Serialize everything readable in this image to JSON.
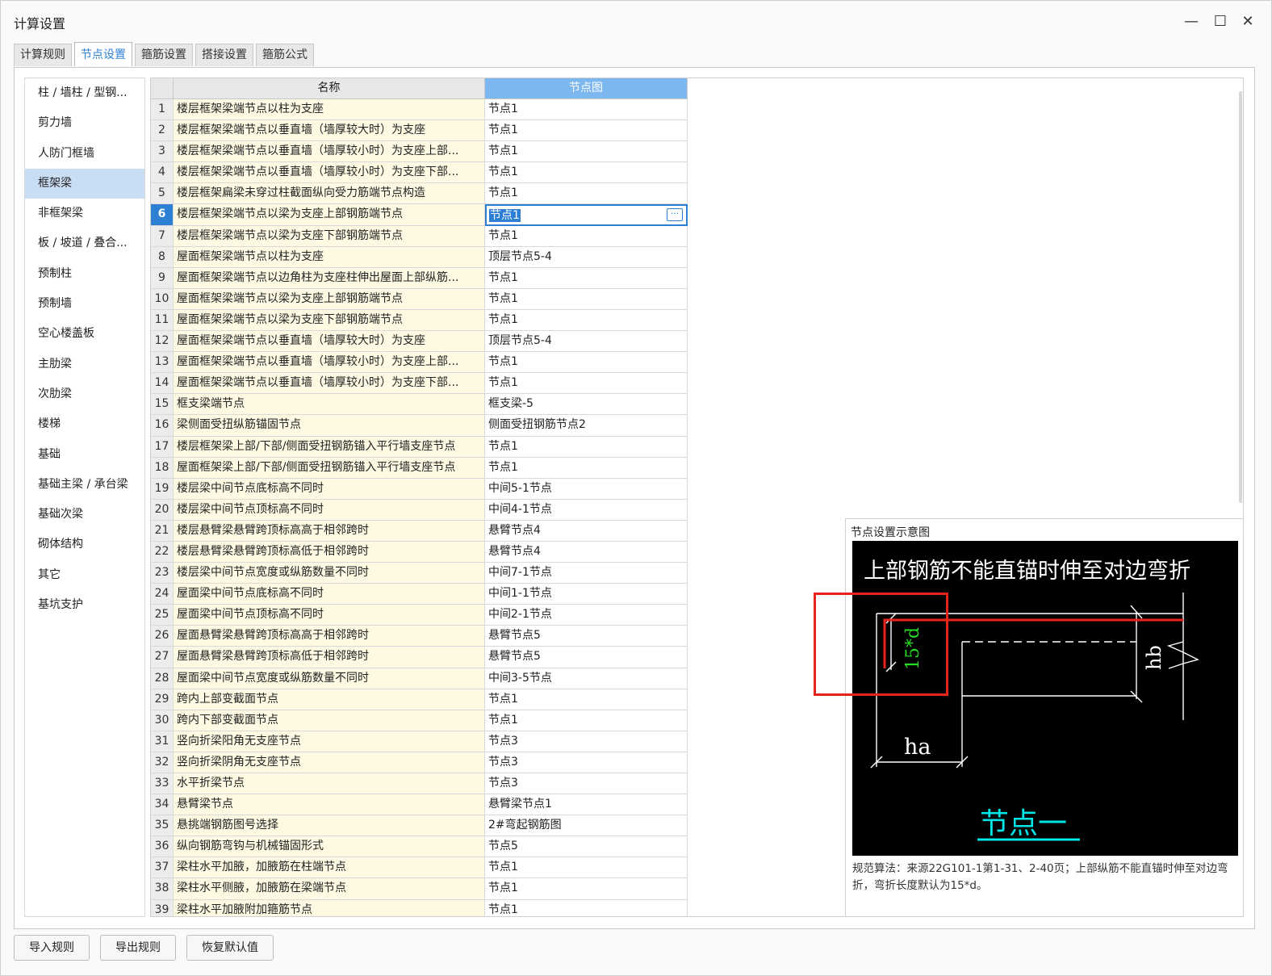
{
  "window": {
    "title": "计算设置"
  },
  "tabs": [
    {
      "label": "计算规则",
      "active": false
    },
    {
      "label": "节点设置",
      "active": true
    },
    {
      "label": "箍筋设置",
      "active": false
    },
    {
      "label": "搭接设置",
      "active": false
    },
    {
      "label": "箍筋公式",
      "active": false
    }
  ],
  "nav": [
    {
      "label": "柱 / 墙柱 / 型钢...",
      "selected": false
    },
    {
      "label": "剪力墙",
      "selected": false
    },
    {
      "label": "人防门框墙",
      "selected": false
    },
    {
      "label": "框架梁",
      "selected": true
    },
    {
      "label": "非框架梁",
      "selected": false
    },
    {
      "label": "板 / 坡道 / 叠合...",
      "selected": false
    },
    {
      "label": "预制柱",
      "selected": false
    },
    {
      "label": "预制墙",
      "selected": false
    },
    {
      "label": "空心楼盖板",
      "selected": false
    },
    {
      "label": "主肋梁",
      "selected": false
    },
    {
      "label": "次肋梁",
      "selected": false
    },
    {
      "label": "楼梯",
      "selected": false
    },
    {
      "label": "基础",
      "selected": false
    },
    {
      "label": "基础主梁 / 承台梁",
      "selected": false
    },
    {
      "label": "基础次梁",
      "selected": false
    },
    {
      "label": "砌体结构",
      "selected": false
    },
    {
      "label": "其它",
      "selected": false
    },
    {
      "label": "基坑支护",
      "selected": false
    }
  ],
  "table": {
    "headers": {
      "name": "名称",
      "value": "节点图"
    },
    "active_row": 6,
    "ellipsis_label": "···",
    "rows": [
      {
        "num": "1",
        "name": "楼层框架梁端节点以柱为支座",
        "value": "节点1"
      },
      {
        "num": "2",
        "name": "楼层框架梁端节点以垂直墙（墙厚较大时）为支座",
        "value": "节点1"
      },
      {
        "num": "3",
        "name": "楼层框架梁端节点以垂直墙（墙厚较小时）为支座上部...",
        "value": "节点1"
      },
      {
        "num": "4",
        "name": "楼层框架梁端节点以垂直墙（墙厚较小时）为支座下部...",
        "value": "节点1"
      },
      {
        "num": "5",
        "name": "楼层框架扁梁未穿过柱截面纵向受力筋端节点构造",
        "value": "节点1"
      },
      {
        "num": "6",
        "name": "楼层框架梁端节点以梁为支座上部钢筋端节点",
        "value": "节点1"
      },
      {
        "num": "7",
        "name": "楼层框架梁端节点以梁为支座下部钢筋端节点",
        "value": "节点1"
      },
      {
        "num": "8",
        "name": "屋面框架梁端节点以柱为支座",
        "value": "顶层节点5-4"
      },
      {
        "num": "9",
        "name": "屋面框架梁端节点以边角柱为支座柱伸出屋面上部纵筋...",
        "value": "节点1"
      },
      {
        "num": "10",
        "name": "屋面框架梁端节点以梁为支座上部钢筋端节点",
        "value": "节点1"
      },
      {
        "num": "11",
        "name": "屋面框架梁端节点以梁为支座下部钢筋端节点",
        "value": "节点1"
      },
      {
        "num": "12",
        "name": "屋面框架梁端节点以垂直墙（墙厚较大时）为支座",
        "value": "顶层节点5-4"
      },
      {
        "num": "13",
        "name": "屋面框架梁端节点以垂直墙（墙厚较小时）为支座上部...",
        "value": "节点1"
      },
      {
        "num": "14",
        "name": "屋面框架梁端节点以垂直墙（墙厚较小时）为支座下部...",
        "value": "节点1"
      },
      {
        "num": "15",
        "name": "框支梁端节点",
        "value": "框支梁-5"
      },
      {
        "num": "16",
        "name": "梁侧面受扭纵筋锚固节点",
        "value": "侧面受扭钢筋节点2"
      },
      {
        "num": "17",
        "name": "楼层框架梁上部/下部/侧面受扭钢筋锚入平行墙支座节点",
        "value": "节点1"
      },
      {
        "num": "18",
        "name": "屋面框架梁上部/下部/侧面受扭钢筋锚入平行墙支座节点",
        "value": "节点1"
      },
      {
        "num": "19",
        "name": "楼层梁中间节点底标高不同时",
        "value": "中间5-1节点"
      },
      {
        "num": "20",
        "name": "楼层梁中间节点顶标高不同时",
        "value": "中间4-1节点"
      },
      {
        "num": "21",
        "name": "楼层悬臂梁悬臂跨顶标高高于相邻跨时",
        "value": "悬臂节点4"
      },
      {
        "num": "22",
        "name": "楼层悬臂梁悬臂跨顶标高低于相邻跨时",
        "value": "悬臂节点4"
      },
      {
        "num": "23",
        "name": "楼层梁中间节点宽度或纵筋数量不同时",
        "value": "中间7-1节点"
      },
      {
        "num": "24",
        "name": "屋面梁中间节点底标高不同时",
        "value": "中间1-1节点"
      },
      {
        "num": "25",
        "name": "屋面梁中间节点顶标高不同时",
        "value": "中间2-1节点"
      },
      {
        "num": "26",
        "name": "屋面悬臂梁悬臂跨顶标高高于相邻跨时",
        "value": "悬臂节点5"
      },
      {
        "num": "27",
        "name": "屋面悬臂梁悬臂跨顶标高低于相邻跨时",
        "value": "悬臂节点5"
      },
      {
        "num": "28",
        "name": "屋面梁中间节点宽度或纵筋数量不同时",
        "value": "中间3-5节点"
      },
      {
        "num": "29",
        "name": "跨内上部变截面节点",
        "value": "节点1"
      },
      {
        "num": "30",
        "name": "跨内下部变截面节点",
        "value": "节点1"
      },
      {
        "num": "31",
        "name": "竖向折梁阳角无支座节点",
        "value": "节点3"
      },
      {
        "num": "32",
        "name": "竖向折梁阴角无支座节点",
        "value": "节点3"
      },
      {
        "num": "33",
        "name": "水平折梁节点",
        "value": "节点3"
      },
      {
        "num": "34",
        "name": "悬臂梁节点",
        "value": "悬臂梁节点1"
      },
      {
        "num": "35",
        "name": "悬挑端钢筋图号选择",
        "value": "2#弯起钢筋图"
      },
      {
        "num": "36",
        "name": "纵向钢筋弯钩与机械锚固形式",
        "value": "节点5"
      },
      {
        "num": "37",
        "name": "梁柱水平加腋，加腋筋在柱端节点",
        "value": "节点1"
      },
      {
        "num": "38",
        "name": "梁柱水平侧腋，加腋筋在梁端节点",
        "value": "节点1"
      },
      {
        "num": "39",
        "name": "梁柱水平加腋附加箍筋节点",
        "value": "节点1"
      }
    ]
  },
  "preview": {
    "title": "节点设置示意图",
    "diagram": {
      "heading": "上部钢筋不能直锚时伸至对边弯折",
      "label_15d": "15*d",
      "label_hb": "hb",
      "label_ha": "ha",
      "caption": "节点一",
      "colors": {
        "bg": "#000000",
        "line": "#ffffff",
        "rebar": "#e8231c",
        "green": "#22dd22",
        "cyan": "#00e5e5"
      }
    },
    "description": "规范算法：来源22G101-1第1-31、2-40页；上部纵筋不能直锚时伸至对边弯折，弯折长度默认为15*d。"
  },
  "buttons": {
    "import": "导入规则",
    "export": "导出规则",
    "restore": "恢复默认值"
  },
  "window_controls": {
    "minimize": "—",
    "maximize": "☐",
    "close": "✕"
  }
}
